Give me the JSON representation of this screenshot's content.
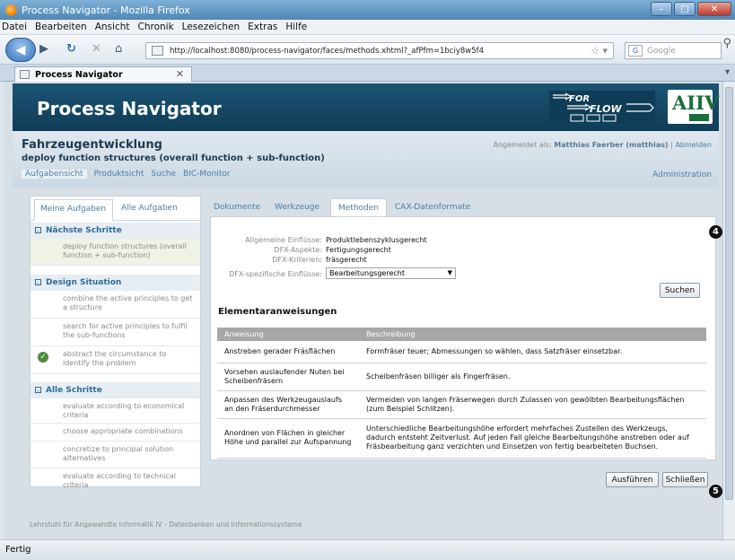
{
  "browser": {
    "window_title": "Process Navigator - Mozilla Firefox",
    "menu": [
      "Datei",
      "Bearbeiten",
      "Ansicht",
      "Chronik",
      "Lesezeichen",
      "Extras",
      "Hilfe"
    ],
    "url": "http://localhost:8080/process-navigator/faces/methods.xhtml?_afPfm=1bciy8w5f4",
    "search_placeholder": "Google",
    "tab_title": "Process Navigator",
    "status": "Fertig"
  },
  "app": {
    "title": "Process Navigator",
    "logo_forflow": "FOR FLOW",
    "logo_aiiv": "AIIV"
  },
  "project": {
    "title": "Fahrzeugentwicklung",
    "subtitle": "deploy function structures (overall function + sub-function)",
    "views": [
      "Aufgabensicht",
      "Produktsicht",
      "Suche",
      "BIC-Monitor"
    ],
    "login_label": "Angemeldet als:",
    "user": "Matthias Faerber (matthias)",
    "separator": "|",
    "logout": "Abmelden",
    "admin": "Administration"
  },
  "sidebar": {
    "tabs": [
      "Meine Aufgaben",
      "Alle Aufgaben"
    ],
    "sections": [
      {
        "title": "Nächste Schritte",
        "items": [
          "deploy function structures (overall function + sub-function)"
        ]
      },
      {
        "title": "Design Situation",
        "items": [
          "combine the active principles to get a structure",
          "search for active principles to fulfil the sub-functions",
          "abstract the circumstance to identify the problem"
        ]
      },
      {
        "title": "Alle Schritte",
        "items": [
          "evaluate according to economical criteria",
          "choose appropriate combinations",
          "concretize to principal solution alternatives",
          "evaluate according to technical criteria"
        ]
      }
    ]
  },
  "main": {
    "tabs": [
      "Dokumente",
      "Werkzeuge",
      "Methoden",
      "CAX-Datenformate"
    ],
    "active_tab": "Methoden",
    "form": [
      {
        "label": "Allgemeine Einflüsse:",
        "value": "Produktlebenszyklusgerecht"
      },
      {
        "label": "DFX-Aspekte:",
        "value": "Fertigungsgerecht"
      },
      {
        "label": "DFX-Kriterien:",
        "value": "fräsgerecht"
      },
      {
        "label": "DFX-spezifische Einflüsse:",
        "value": "Bearbeitungsgerecht"
      }
    ],
    "search_button": "Suchen",
    "section_title": "Elementaranweisungen",
    "table": {
      "headers": [
        "Anweisung",
        "Beschreibung"
      ],
      "rows": [
        [
          "Anstreben gerader Frásflächen",
          "Formfräser teuer; Abmessungen so wählen, dass Satzfräser einsetzbar."
        ],
        [
          "Vorsehen auslaufender Nuten bei Scheibenfräsern",
          "Scheibenfräsen billiger als Fingerfräsen."
        ],
        [
          "Anpassen des Werkzeugauslaufs an den Fräserdurchmesser",
          "Vermeiden von langen Fräserwegen durch Zulassen von gewölbten Bearbeitungsflächen (zum Beispiel Schlitzen)."
        ],
        [
          "Anordnen von Flächen in gleicher Höhe und parallel zur Aufspannung",
          "Unterschiedliche Bearbeitungshöhe erfordert mehrfaches Zustellen des Werkzeugs, dadurch entsteht Zeitverlust. Auf jeden Fall gleiche Bearbeitungshöhe anstreben oder auf Fräsbearbeitung ganz verzichten und Einsetzen von fertig bearbeiteten Buchsen."
        ]
      ]
    },
    "run_button": "Ausführen",
    "close_button": "Schließen"
  },
  "badges": [
    "4",
    "5"
  ],
  "footer": "Lehrstuhl für Angewandte Informatik IV - Datenbanken und Informationssysteme"
}
